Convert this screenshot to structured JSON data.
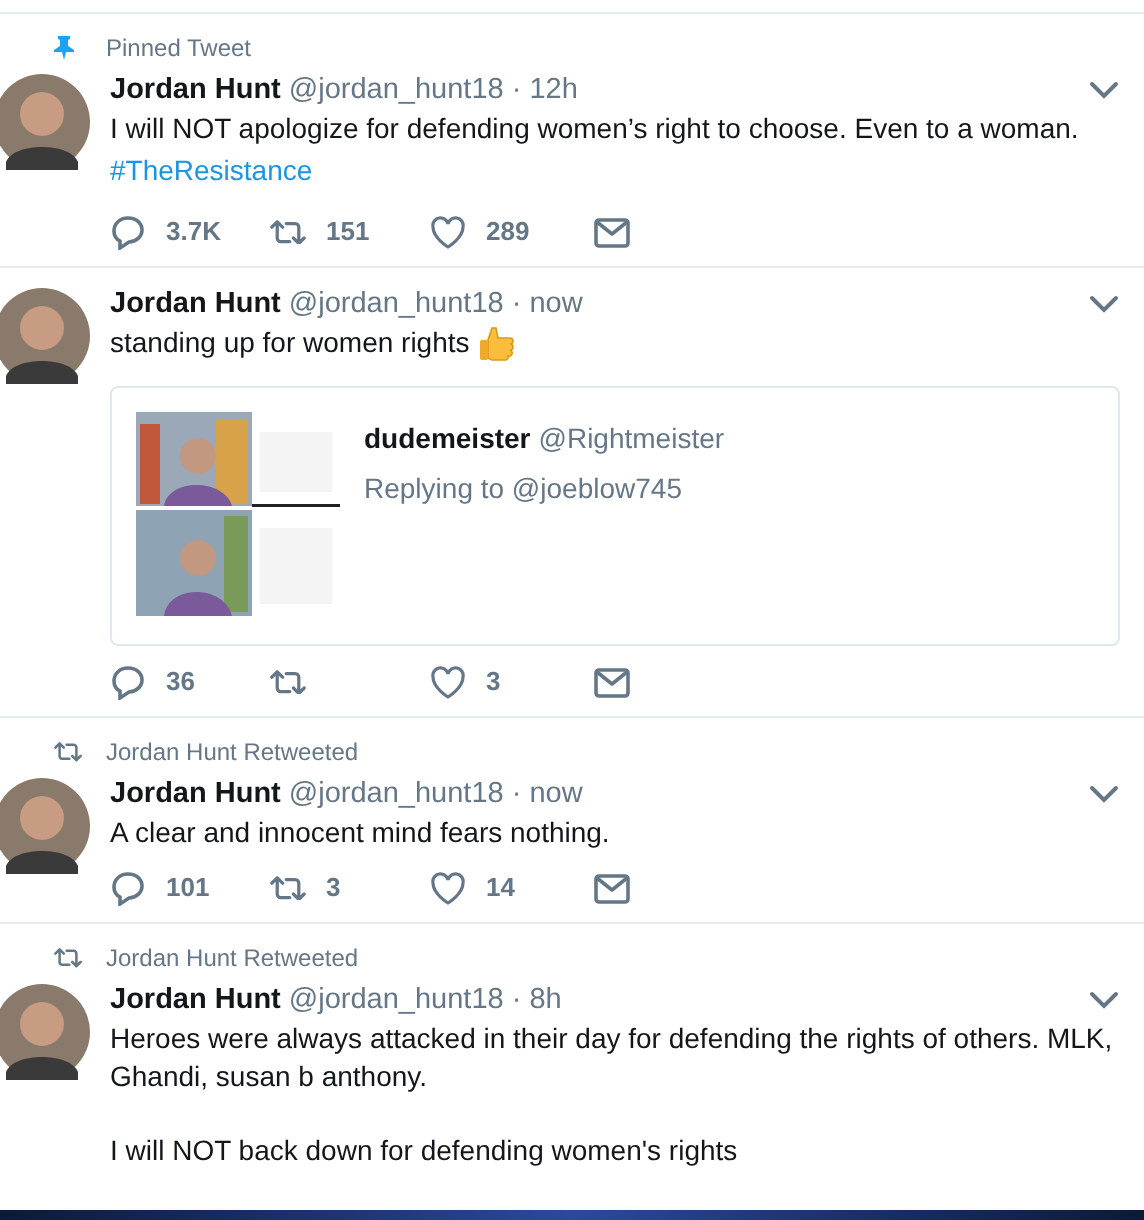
{
  "tweets": [
    {
      "context": {
        "kind": "pinned",
        "text": "Pinned Tweet"
      },
      "name": "Jordan Hunt",
      "handle": "@jordan_hunt18",
      "time": "· 12h",
      "lines": [
        {
          "kind": "text",
          "text": "I will NOT apologize for defending women’s right to choose. Even to a woman."
        },
        {
          "kind": "link",
          "text": "#TheResistance"
        }
      ],
      "actions": {
        "replies": "3.7K",
        "retweets": "151",
        "likes": "289"
      }
    },
    {
      "name": "Jordan Hunt",
      "handle": "@jordan_hunt18",
      "time": "· now",
      "lines": [
        {
          "kind": "emoji_text",
          "text": "standing up for women rights"
        }
      ],
      "quote": {
        "kind": "picture",
        "name": "dudemeister",
        "handle": "@Rightmeister",
        "reply": "Replying to @joeblow745"
      },
      "actions": {
        "replies": "36",
        "likes": "3"
      }
    },
    {
      "context": {
        "kind": "retweet",
        "text": "Jordan Hunt Retweeted"
      },
      "name": "Jordan Hunt",
      "handle": "@jordan_hunt18",
      "time": "· now",
      "lines": [
        {
          "kind": "text",
          "text": "A clear and innocent mind fears nothing."
        }
      ],
      "actions": {
        "replies": "101",
        "retweets": "3",
        "likes": "14"
      }
    },
    {
      "context": {
        "kind": "retweet",
        "text": "Jordan Hunt Retweeted"
      },
      "name": "Jordan Hunt",
      "handle": "@jordan_hunt18",
      "time": "· 8h",
      "lines": [
        {
          "kind": "text",
          "text": "Heroes were always attacked in their day for defending the rights of others. MLK, Ghandi, susan b anthony."
        },
        {
          "kind": "blank"
        },
        {
          "kind": "text",
          "text": "I will NOT back down for defending women's rights"
        }
      ]
    }
  ]
}
